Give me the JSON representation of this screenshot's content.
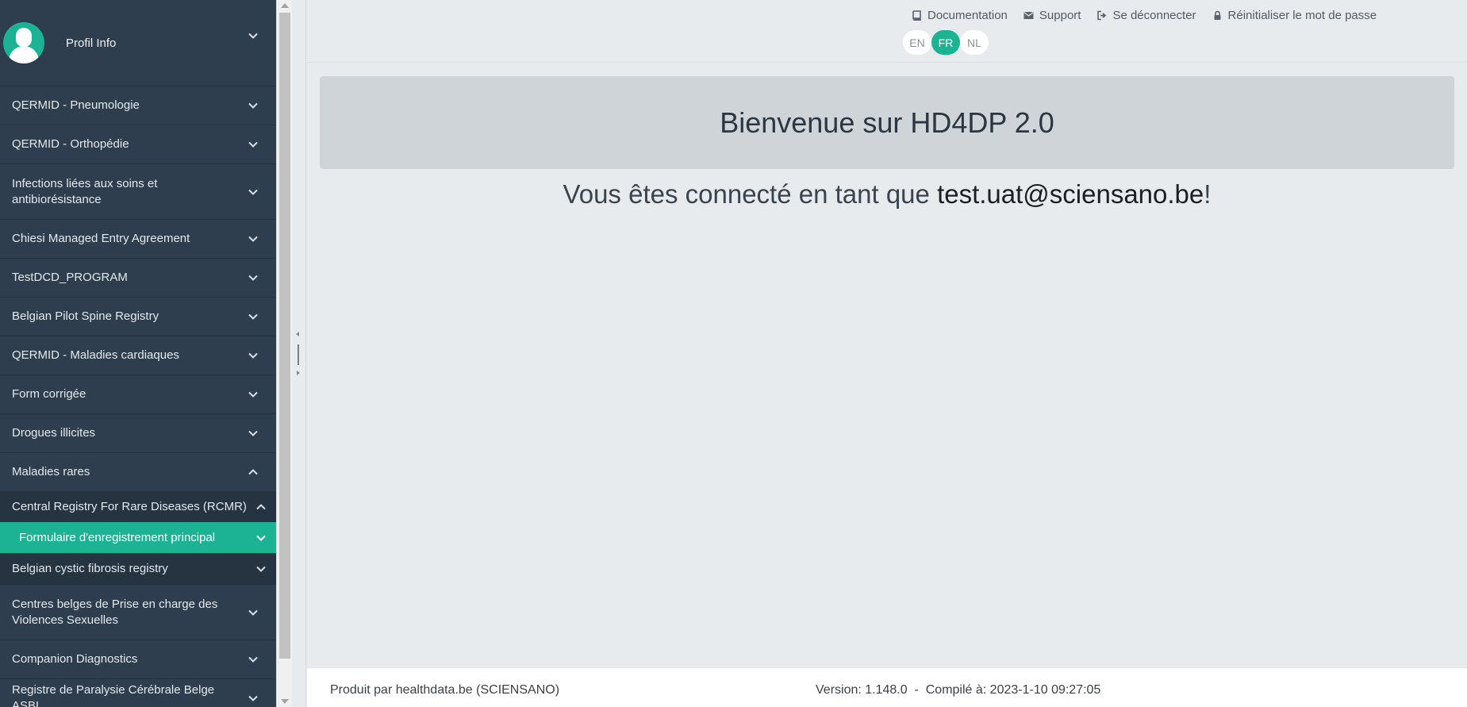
{
  "sidebar": {
    "profile_label": "Profil Info",
    "items": [
      {
        "label": "QERMID - Pneumologie"
      },
      {
        "label": "QERMID - Orthopédie"
      },
      {
        "label": "Infections liées aux soins et antibiorésistance"
      },
      {
        "label": "Chiesi Managed Entry Agreement"
      },
      {
        "label": "TestDCD_PROGRAM"
      },
      {
        "label": "Belgian Pilot Spine Registry"
      },
      {
        "label": "QERMID - Maladies cardiaques"
      },
      {
        "label": "Form corrigée"
      },
      {
        "label": "Drogues illicites"
      },
      {
        "label": "Maladies rares"
      }
    ],
    "sub_items": [
      {
        "label": "Central Registry For Rare Diseases (RCMR)"
      },
      {
        "label": "Formulaire d'enregistrement principal"
      },
      {
        "label": "Belgian cystic fibrosis registry"
      }
    ],
    "items_after": [
      {
        "label": "Centres belges de Prise en charge des Violences Sexuelles"
      },
      {
        "label": "Companion Diagnostics"
      },
      {
        "label": "Registre de Paralysie Cérébrale Belge ASBL"
      }
    ]
  },
  "topbar": {
    "links": [
      {
        "label": "Documentation",
        "icon": "book-icon"
      },
      {
        "label": "Support",
        "icon": "envelope-icon"
      },
      {
        "label": "Se déconnecter",
        "icon": "sign-out-icon"
      },
      {
        "label": "Réinitialiser le mot de passe",
        "icon": "lock-icon"
      }
    ],
    "languages": [
      "EN",
      "FR",
      "NL"
    ],
    "active_language": "FR"
  },
  "main": {
    "welcome_title": "Bienvenue sur HD4DP 2.0",
    "connected_prefix": "Vous êtes connecté en tant que ",
    "connected_email": "test.uat@sciensano.be",
    "connected_suffix": "!"
  },
  "footer": {
    "produced_by": "Produit par healthdata.be (SCIENSANO)",
    "version_text": "Version: 1.148.0  -  Compilé à: 2023-1-10 09:27:05"
  },
  "colors": {
    "sidebar_bg": "#2f3e4e",
    "accent": "#1bb394",
    "main_bg": "#e8ebee",
    "welcome_box_bg": "#cfd4d8"
  }
}
